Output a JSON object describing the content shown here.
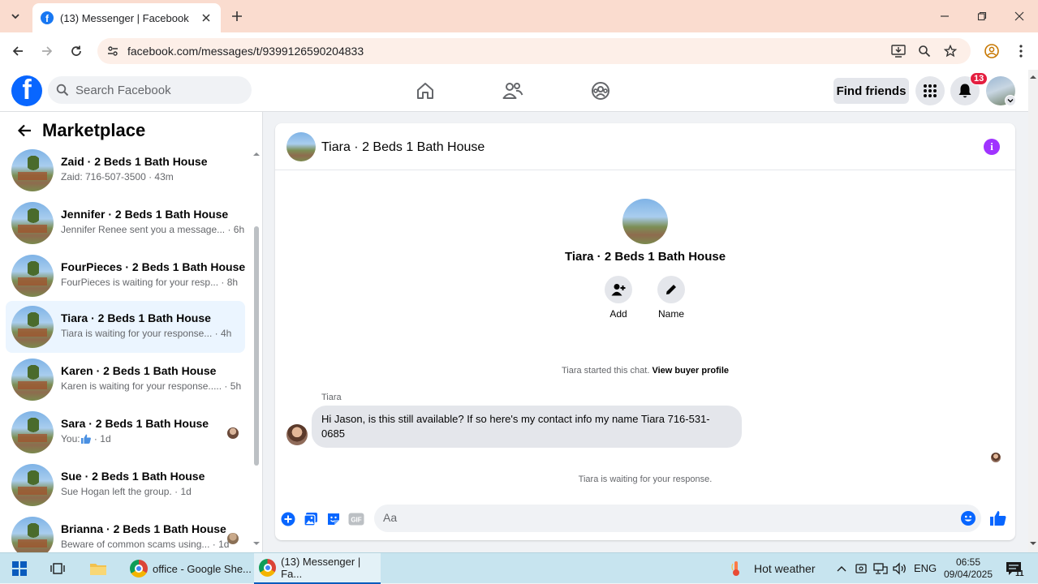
{
  "browser": {
    "tab_title": "(13) Messenger | Facebook",
    "url": "facebook.com/messages/t/9399126590204833"
  },
  "header": {
    "search_placeholder": "Search Facebook",
    "find_friends_label": "Find friends",
    "notification_count": "13"
  },
  "sidebar": {
    "title": "Marketplace",
    "conversations": [
      {
        "name": "Zaid · 2 Beds 1 Bath House",
        "preview": "Zaid: 716-507-3500",
        "time": "43m"
      },
      {
        "name": "Jennifer · 2 Beds 1 Bath House",
        "preview": "Jennifer Renee sent you a message...",
        "time": "6h"
      },
      {
        "name": "FourPieces · 2 Beds 1 Bath House",
        "preview": "FourPieces is waiting for your resp...",
        "time": "8h"
      },
      {
        "name": "Tiara · 2 Beds 1 Bath House",
        "preview": "Tiara is waiting for your response...",
        "time": "4h",
        "active": true
      },
      {
        "name": "Karen · 2 Beds 1 Bath House",
        "preview": "Karen is waiting for your response.....",
        "time": "5h"
      },
      {
        "name": "Sara · 2 Beds 1 Bath House",
        "preview": "You: ",
        "time": "1d"
      },
      {
        "name": "Sue · 2 Beds 1 Bath House",
        "preview": "Sue Hogan left the group.",
        "time": "1d"
      },
      {
        "name": "Brianna · 2 Beds 1 Bath House",
        "preview": "Beware of common scams using...",
        "time": "1d"
      }
    ]
  },
  "chat": {
    "header_name": "Tiara · 2 Beds 1 Bath House",
    "profile_name": "Tiara · 2 Beds 1 Bath House",
    "add_label": "Add",
    "name_label": "Name",
    "started_text": "Tiara started this chat.",
    "buyer_profile_link": "View buyer profile",
    "sender_name": "Tiara",
    "message": "Hi Jason, is this still available? If so here's my contact info my name Tiara 716-531-0685",
    "waiting_text": "Tiara is waiting for your response.",
    "composer_placeholder": "Aa"
  },
  "taskbar": {
    "apps": [
      {
        "label": "office - Google She..."
      },
      {
        "label": "(13) Messenger | Fa..."
      }
    ],
    "weather": "Hot weather",
    "language": "ENG",
    "time": "06:55",
    "date": "09/04/2025",
    "notification_count": "11"
  },
  "colors": {
    "facebook_blue": "#0866ff",
    "active_conversation": "#ebf5ff",
    "info_purple": "#a033ff",
    "notification_red": "#e41e3f"
  }
}
